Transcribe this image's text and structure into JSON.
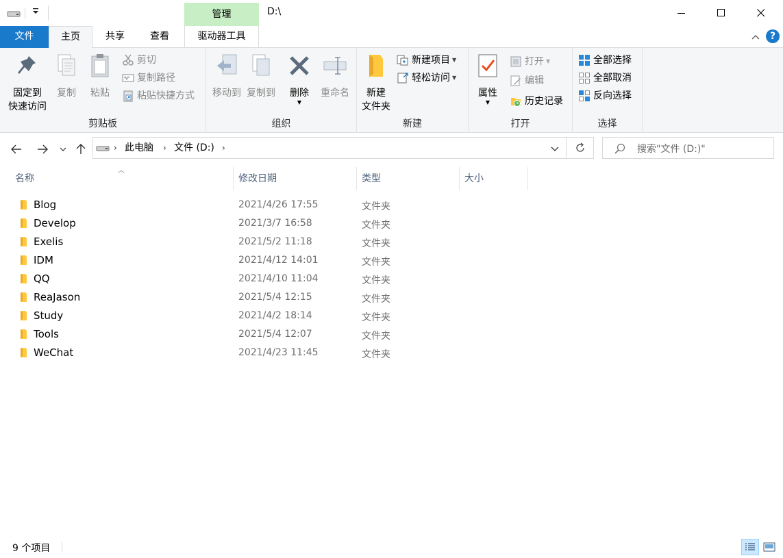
{
  "window": {
    "title": "D:\\",
    "context_tab": "管理"
  },
  "tabs": {
    "file": "文件",
    "home": "主页",
    "share": "共享",
    "view": "查看",
    "drive_tools": "驱动器工具"
  },
  "ribbon": {
    "help": "?",
    "clipboard": {
      "label": "剪贴板",
      "pin_line1": "固定到",
      "pin_line2": "快速访问",
      "copy": "复制",
      "paste": "粘贴",
      "cut": "剪切",
      "copy_path": "复制路径",
      "paste_shortcut": "粘贴快捷方式"
    },
    "organize": {
      "label": "组织",
      "move_to": "移动到",
      "copy_to": "复制到",
      "delete": "删除",
      "rename": "重命名"
    },
    "new": {
      "label": "新建",
      "new_folder_line1": "新建",
      "new_folder_line2": "文件夹",
      "new_item": "新建项目",
      "easy_access": "轻松访问"
    },
    "open": {
      "label": "打开",
      "properties": "属性",
      "open": "打开",
      "edit": "编辑",
      "history": "历史记录"
    },
    "select": {
      "label": "选择",
      "select_all": "全部选择",
      "select_none": "全部取消",
      "invert": "反向选择"
    }
  },
  "address": {
    "crumbs": [
      "此电脑",
      "文件 (D:)"
    ],
    "search_placeholder": "搜索\"文件 (D:)\""
  },
  "columns": {
    "name": "名称",
    "date": "修改日期",
    "type": "类型",
    "size": "大小"
  },
  "files": [
    {
      "name": "Blog",
      "date": "2021/4/26 17:55",
      "type": "文件夹"
    },
    {
      "name": "Develop",
      "date": "2021/3/7 16:58",
      "type": "文件夹"
    },
    {
      "name": "Exelis",
      "date": "2021/5/2 11:18",
      "type": "文件夹"
    },
    {
      "name": "IDM",
      "date": "2021/4/12 14:01",
      "type": "文件夹"
    },
    {
      "name": "QQ",
      "date": "2021/4/10 11:04",
      "type": "文件夹"
    },
    {
      "name": "ReaJason",
      "date": "2021/5/4 12:15",
      "type": "文件夹"
    },
    {
      "name": "Study",
      "date": "2021/4/2 18:14",
      "type": "文件夹"
    },
    {
      "name": "Tools",
      "date": "2021/5/4 12:07",
      "type": "文件夹"
    },
    {
      "name": "WeChat",
      "date": "2021/4/23 11:45",
      "type": "文件夹"
    }
  ],
  "status": {
    "item_count": "9 个项目"
  },
  "colors": {
    "file_tab": "#1979ca",
    "manage_tab": "#c7eec4",
    "folder": "#ffc83d"
  }
}
